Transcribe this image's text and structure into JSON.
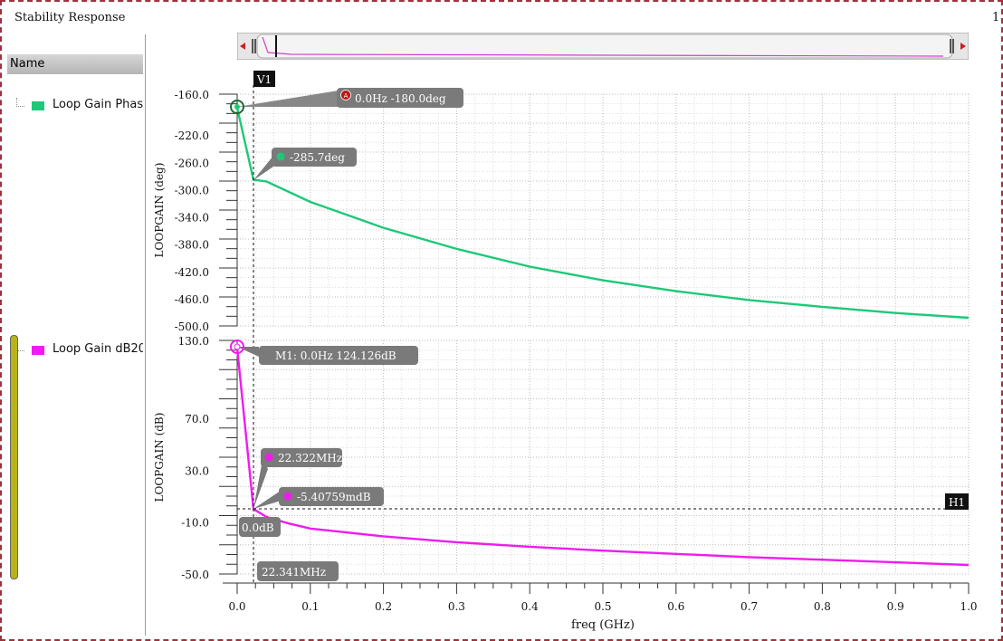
{
  "window": {
    "title": "Stability Response",
    "page_number": "1"
  },
  "legend": {
    "header": "Name",
    "items": [
      {
        "label": "Loop Gain Phase",
        "color": "#1ec878"
      },
      {
        "label": "Loop Gain dB20",
        "color": "#ee1cee"
      }
    ]
  },
  "colors": {
    "phase": "#1ec878",
    "gain": "#ee1cee",
    "marker_box": "#7a7a7a",
    "label_box": "#111111",
    "scroller_trace": "#d040d0"
  },
  "chart_data": [
    {
      "type": "line",
      "xlabel": "",
      "ylabel": "LOOPGAIN (deg)",
      "xlim": [
        0,
        1
      ],
      "ylim": [
        -500,
        -160
      ],
      "y_ticks": [
        "-160.0",
        "-220.0",
        "-260.0",
        "-300.0",
        "-340.0",
        "-380.0",
        "-420.0",
        "-460.0",
        "-500.0"
      ],
      "grid": true,
      "series": [
        {
          "name": "Loop Gain Phase",
          "x": [
            0,
            0.0223,
            0.04,
            0.1,
            0.2,
            0.3,
            0.4,
            0.5,
            0.6,
            0.7,
            0.8,
            0.9,
            1.0
          ],
          "y": [
            -180,
            -285.7,
            -288,
            -318,
            -356,
            -387,
            -413,
            -433,
            -449,
            -462,
            -472,
            -481,
            -488
          ]
        }
      ],
      "annotations": [
        {
          "text": "0.0Hz -180.0deg",
          "badge": "A",
          "x": 0,
          "y": -180
        },
        {
          "text": "-285.7deg",
          "x": 0.0223,
          "y": -285.7
        }
      ]
    },
    {
      "type": "line",
      "xlabel": "freq (GHz)",
      "ylabel": "LOOPGAIN (dB)",
      "xlim": [
        0,
        1
      ],
      "ylim": [
        -50,
        130
      ],
      "x_ticks": [
        "0.0",
        "0.1",
        "0.2",
        "0.3",
        "0.4",
        "0.5",
        "0.6",
        "0.7",
        "0.8",
        "0.9",
        "1.0"
      ],
      "y_ticks": [
        "130.0",
        "70.0",
        "30.0",
        "-10.0",
        "-50.0"
      ],
      "grid": true,
      "series": [
        {
          "name": "Loop Gain dB20",
          "x": [
            0,
            0.0223,
            0.04,
            0.07,
            0.1,
            0.2,
            0.3,
            0.4,
            0.5,
            0.6,
            0.7,
            0.8,
            0.9,
            1.0
          ],
          "y": [
            124.126,
            0,
            -6,
            -11,
            -15,
            -21,
            -25.5,
            -29,
            -32,
            -34.5,
            -37,
            -39,
            -41,
            -43
          ]
        }
      ],
      "annotations": [
        {
          "text": "M1: 0.0Hz 124.126dB",
          "x": 0,
          "y": 124.126
        },
        {
          "text": "22.322MHz",
          "x": 0.022322,
          "y": 0
        },
        {
          "text": "-5.40759mdB",
          "x": 0.022322,
          "y": 0
        },
        {
          "text": "0.0dB",
          "x": 0,
          "y": 0
        },
        {
          "text": "22.341MHz",
          "x": 0.022341,
          "y": -50
        }
      ],
      "cursors": [
        {
          "label": "V1",
          "orientation": "vertical",
          "x": 0.022341
        },
        {
          "label": "H1",
          "orientation": "horizontal",
          "y": 0
        }
      ]
    }
  ]
}
